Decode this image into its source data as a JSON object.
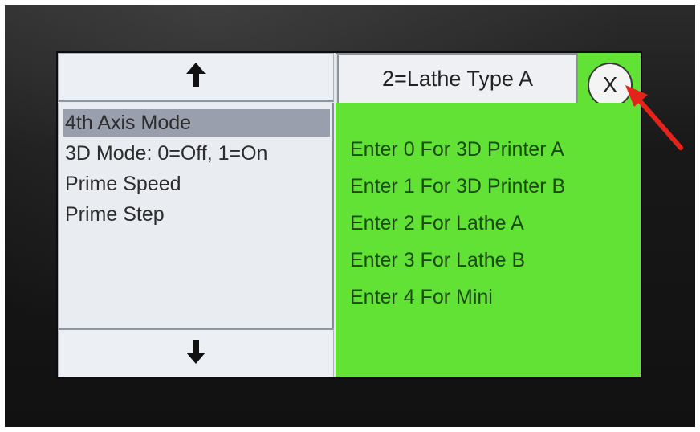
{
  "nav": {
    "up_icon": "arrow-up-icon",
    "down_icon": "arrow-down-icon"
  },
  "menu": {
    "items": [
      {
        "label": "4th Axis Mode",
        "selected": true
      },
      {
        "label": "3D Mode: 0=Off, 1=On",
        "selected": false
      },
      {
        "label": "Prime Speed",
        "selected": false
      },
      {
        "label": "Prime Step",
        "selected": false
      }
    ]
  },
  "header": {
    "value_label": "2=Lathe Type A",
    "close_label": "X"
  },
  "instructions": [
    "Enter 0 For 3D Printer A",
    "Enter 1 For 3D Printer B",
    "Enter 2 For Lathe A",
    "Enter 3 For Lathe B",
    "Enter 4 For Mini"
  ],
  "colors": {
    "panel_green": "#61e235",
    "selection": "#9a9fad",
    "annotation_arrow": "#e4241b"
  }
}
